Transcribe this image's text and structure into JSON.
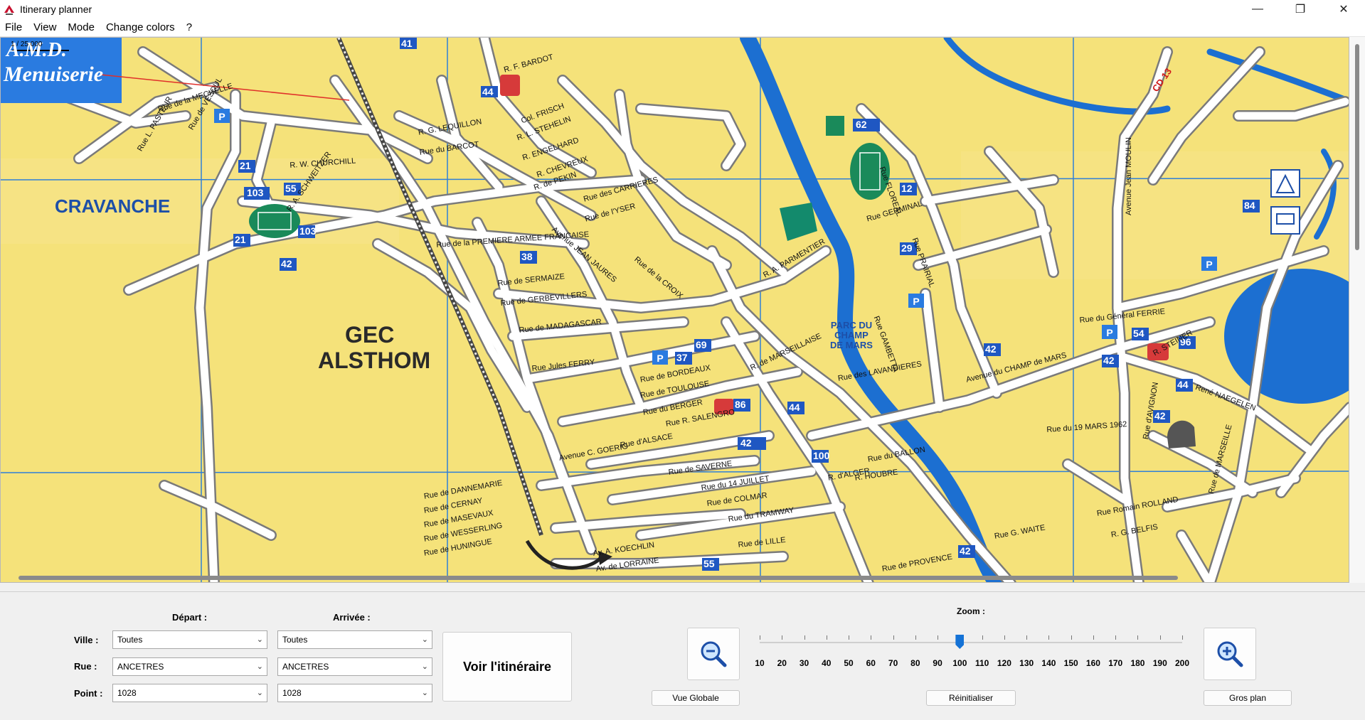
{
  "window": {
    "title": "Itinerary planner",
    "controls": {
      "minimize": "—",
      "maximize": "❐",
      "close": "✕"
    }
  },
  "menu": [
    "File",
    "View",
    "Mode",
    "Change colors",
    "?"
  ],
  "map": {
    "place_labels": {
      "cravanche": "CRAVANCHE",
      "gec1": "GEC",
      "gec2": "ALSTHOM",
      "parc1": "PARC DU",
      "parc2": "CHAMP",
      "parc3": "DE MARS",
      "cd13": "CD 13",
      "logo1": "A.M.D.",
      "logo2": "Menuiserie",
      "scale": "1 / 25 000"
    },
    "streets": [
      "Rue de la MECHELLE",
      "Rue de VESOUL",
      "Rue L. PASTEUR",
      "R. W. CHURCHILL",
      "R. A. SCHWEITZER",
      "Rue de la PREMIERE ARMEE FRANCAISE",
      "Rue du BARCOT",
      "R. G. LEQUILLON",
      "R. F. BARDOT",
      "Col. FRISCH",
      "R. L. STEHELIN",
      "R. ENGELHARD",
      "R. CHEVREUX",
      "R. de PEKIN",
      "Rue des CARRIERES",
      "Rue de l'YSER",
      "Avenue JEAN JAURES",
      "Rue de SERMAIZE",
      "Rue de GERBEVILLERS",
      "Rue de MADAGASCAR",
      "Rue Jules FERRY",
      "Rue de BORDEAUX",
      "Rue de TOULOUSE",
      "Rue du BERGER",
      "Rue R. SALENGRO",
      "Rue d'ALSACE",
      "Avenue C. GOERIG",
      "Rue de SAVERNE",
      "Rue du 14 JUILLET",
      "Rue de COLMAR",
      "Rue du TRAMWAY",
      "Rue de LILLE",
      "Avenue du CHAMP de MARS",
      "Rue GERMINAL",
      "Rue FLOREAL",
      "Rue PRAIRIAL",
      "R. A. PARMENTIER",
      "Rue de la CROIX",
      "Rue du Général FERRIE",
      "R. STEINER",
      "René NAEGELEN",
      "Rue du 19 MARS 1962",
      "Rue Romain ROLLAND",
      "R. G. BELFIS",
      "Rue de MARSEILLE",
      "Avenue Jean MOULIN",
      "Rue d'AVIGNON",
      "Rue de PROVENCE",
      "Rue de DANNEMARIE",
      "Rue de CERNAY",
      "Rue de MASEVAUX",
      "Rue de WESSERLING",
      "Rue de HUNINGUE",
      "Av. A. KOECHLIN",
      "Av. de LORRAINE",
      "Rue des LAVANDIERES",
      "R. HOUBRE",
      "Rue du BALLON",
      "R. d'ALGER",
      "R. de MARSEILLAISE",
      "Rue G. WAITE",
      "Rue GAMBETTA"
    ],
    "numbers": [
      "41",
      "44",
      "103",
      "55",
      "21",
      "103",
      "42",
      "21",
      "38",
      "37",
      "69",
      "86",
      "44",
      "42",
      "100",
      "42",
      "42",
      "54",
      "96",
      "44",
      "42",
      "42",
      "84",
      "29",
      "12",
      "62",
      "55",
      "103"
    ]
  },
  "panel": {
    "depart_label": "Départ :",
    "arrivee_label": "Arrivée :",
    "ville_label": "Ville :",
    "rue_label": "Rue :",
    "point_label": "Point :",
    "depart": {
      "ville": "Toutes",
      "rue": "ANCETRES",
      "point": "1028"
    },
    "arrivee": {
      "ville": "Toutes",
      "rue": "ANCETRES",
      "point": "1028"
    },
    "voir_button": "Voir l'itinéraire",
    "zoom_label": "Zoom :",
    "zoom_value": 100,
    "zoom_ticks": [
      "10",
      "20",
      "30",
      "40",
      "50",
      "60",
      "70",
      "80",
      "90",
      "100",
      "110",
      "120",
      "130",
      "140",
      "150",
      "160",
      "170",
      "180",
      "190",
      "200"
    ],
    "vue_globale": "Vue Globale",
    "reinitialiser": "Réinitialiser",
    "gros_plan": "Gros plan",
    "zoom_out_icon": "zoom-out-icon",
    "zoom_in_icon": "zoom-in-icon"
  },
  "colors": {
    "map_bg": "#f5e27a",
    "road": "#ffffff",
    "water": "#1c6fd1",
    "grid": "#2f7fd8",
    "label_blue": "#1d4fa8",
    "zoom_thumb": "#1472d6"
  }
}
